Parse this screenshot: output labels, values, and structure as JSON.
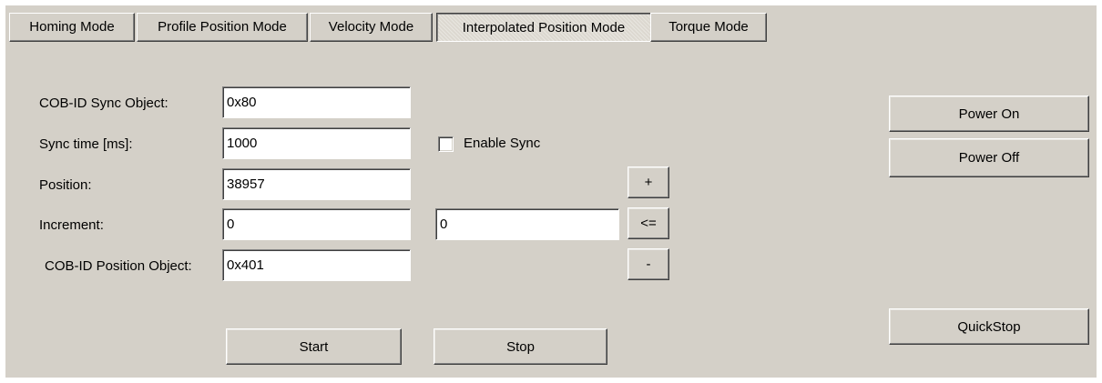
{
  "tabs": [
    {
      "label": "Homing Mode"
    },
    {
      "label": "Profile Position Mode"
    },
    {
      "label": "Velocity Mode"
    },
    {
      "label": "Interpolated Position Mode"
    },
    {
      "label": "Torque Mode"
    }
  ],
  "active_tab": "Interpolated Position Mode",
  "form": {
    "cob_id_sync": {
      "label": "COB-ID Sync Object:",
      "value": "0x80"
    },
    "sync_time": {
      "label": "Sync time [ms]:",
      "value": "1000"
    },
    "position": {
      "label": "Position:",
      "value": "38957"
    },
    "increment": {
      "label": "Increment:",
      "value": "0",
      "value2": "0"
    },
    "cob_id_position": {
      "label": "COB-ID Position Object:",
      "value": "0x401"
    }
  },
  "enable_sync": {
    "label": "Enable Sync",
    "checked": false
  },
  "buttons": {
    "plus": "+",
    "apply": "<=",
    "minus": "-",
    "start": "Start",
    "stop": "Stop",
    "power_on": "Power On",
    "power_off": "Power Off",
    "quickstop": "QuickStop"
  },
  "colors": {
    "panel": "#d4d0c8",
    "field_bg": "#ffffff"
  }
}
